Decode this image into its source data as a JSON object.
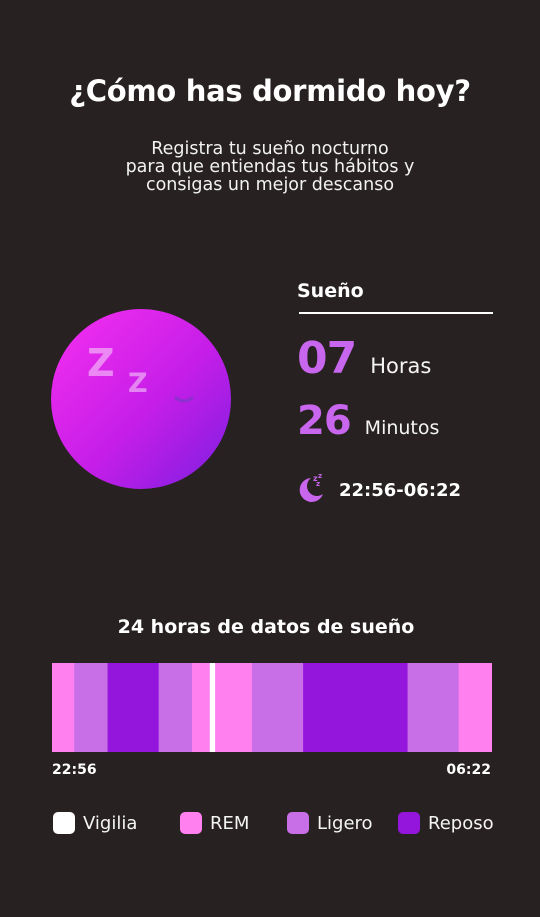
{
  "header": {
    "title": "¿Cómo has dormido hoy?",
    "subtitle_lines": [
      "Registra tu sueño nocturno",
      "para que entiendas tus hábitos y",
      "consigas un mejor descanso"
    ]
  },
  "summary": {
    "section_label": "Sueño",
    "hours_value": "07",
    "hours_unit": "Horas",
    "minutes_value": "26",
    "minutes_unit": "Minutos",
    "time_range": "22:56-06:22"
  },
  "timeline": {
    "title": "24 horas de datos de sueño",
    "start_label": "22:56",
    "end_label": "06:22"
  },
  "legend": [
    {
      "label": "Vigilia",
      "color": "#ffffff"
    },
    {
      "label": "REM",
      "color": "#ff80ee"
    },
    {
      "label": "Ligero",
      "color": "#c86ee6"
    },
    {
      "label": "Reposo",
      "color": "#9416dc"
    }
  ],
  "chart_data": {
    "type": "bar",
    "stacked_timeline": true,
    "start": "22:56",
    "end": "06:22",
    "stage_colors": {
      "Vigilia": "#ffffff",
      "REM": "#ff80ee",
      "Ligero": "#c86ee6",
      "Reposo": "#9416dc"
    },
    "segments": [
      {
        "stage": "REM",
        "share": 0.05
      },
      {
        "stage": "Ligero",
        "share": 0.075
      },
      {
        "stage": "Reposo",
        "share": 0.115
      },
      {
        "stage": "Ligero",
        "share": 0.075
      },
      {
        "stage": "REM",
        "share": 0.04
      },
      {
        "stage": "Vigilia",
        "share": 0.012
      },
      {
        "stage": "REM",
        "share": 0.083
      },
      {
        "stage": "Ligero",
        "share": 0.115
      },
      {
        "stage": "Reposo",
        "share": 0.235
      },
      {
        "stage": "Ligero",
        "share": 0.115
      },
      {
        "stage": "REM",
        "share": 0.075
      }
    ]
  }
}
